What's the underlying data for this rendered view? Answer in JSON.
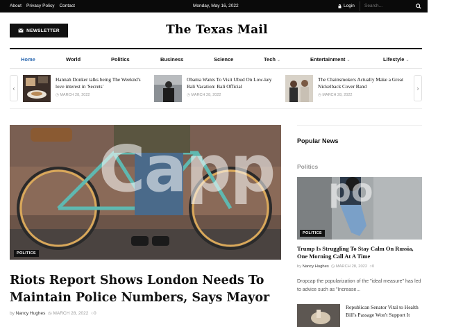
{
  "topbar": {
    "links": [
      "About",
      "Privacy Policy",
      "Contact"
    ],
    "date": "Monday, May 16, 2022",
    "login_label": "Login",
    "search_placeholder": "Search..."
  },
  "header": {
    "newsletter_label": "NEWSLETTER",
    "site_title": "The Texas Mail"
  },
  "nav": {
    "items": [
      {
        "label": "Home",
        "dropdown": false
      },
      {
        "label": "World",
        "dropdown": false
      },
      {
        "label": "Politics",
        "dropdown": false
      },
      {
        "label": "Business",
        "dropdown": false
      },
      {
        "label": "Science",
        "dropdown": false
      },
      {
        "label": "Tech",
        "dropdown": true
      },
      {
        "label": "Entertainment",
        "dropdown": true
      },
      {
        "label": "Lifestyle",
        "dropdown": true
      }
    ],
    "active": "Home"
  },
  "ticker": {
    "items": [
      {
        "title": "Hannah Donker talks being The Weeknd's love interest in 'Secrets'",
        "date": "MARCH 28, 2022"
      },
      {
        "title": "Obama Wants To Visit Ubud On Low-key Bali Vacation: Bali Official",
        "date": "MARCH 28, 2022"
      },
      {
        "title": "The Chainsmokers Actually Make a Great Nickelback Cover Band",
        "date": "MARCH 28, 2022"
      }
    ]
  },
  "hero": {
    "category": "POLITICS",
    "watermark": "Capp",
    "title": "Riots Report Shows London Needs To Maintain Police Numbers, Says Mayor",
    "author_prefix": "by",
    "author": "Nancy Hughes",
    "date": "MARCH 28, 2022",
    "comments": "0"
  },
  "sidebar": {
    "popular_heading": "Popular News",
    "section_heading": "Politics",
    "featured": {
      "category": "POLITICS",
      "title": "Trump Is Struggling To Stay Calm On Russia, One Morning Call At A Time",
      "author_prefix": "by",
      "author": "Nancy Hughes",
      "date": "MARCH 28, 2022",
      "comments": "0",
      "excerpt": "Dropcap the popularization of the \"ideal measure\" has led to advice such as \"Increase..."
    },
    "next": {
      "title": "Republican Senator Vital to Health Bill's Passage Won't Support It"
    }
  },
  "colors": {
    "accent": "#2e6ab1",
    "topbar_bg": "#0a0a0a",
    "meta_text": "#999999"
  }
}
